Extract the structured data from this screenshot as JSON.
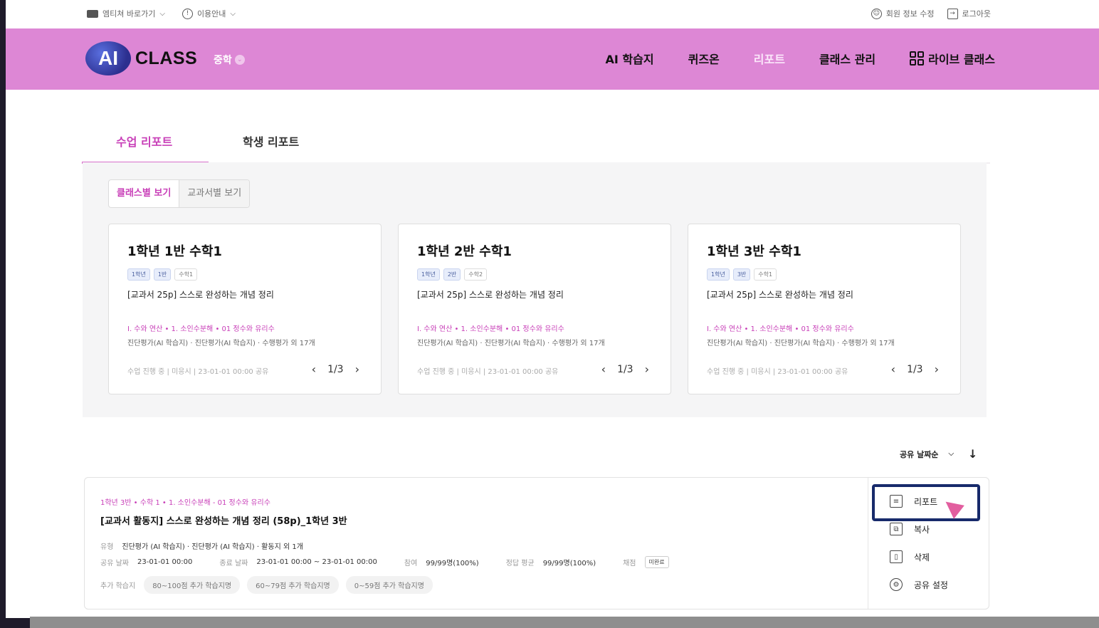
{
  "utilbar": {
    "shortcut_label": "엠티쳐 바로가기",
    "guide_label": "이용안내",
    "profile_label": "회원 정보 수정",
    "logout_label": "로그아웃"
  },
  "header": {
    "logo_ai": "AI",
    "logo_class": "CLASS",
    "grade": "중학",
    "nav": [
      "AI 학습지",
      "퀴즈온",
      "리포트",
      "클래스 관리",
      "라이브 클래스"
    ],
    "active_nav": "리포트"
  },
  "tabs": [
    "수업 리포트",
    "학생 리포트"
  ],
  "view_toggle": [
    "클래스별 보기",
    "교과서별 보기"
  ],
  "cards": [
    {
      "title": "1학년 1반 수학1",
      "tags": [
        "1학년",
        "1반",
        "수학1"
      ],
      "subtitle": "[교과서 25p] 스스로 완성하는 개념 정리",
      "path": "Ⅰ. 수와 연산  •  1. 소인수분해  •  01 정수와 유리수",
      "types": "진단평가(AI 학습지) · 진단평가(AI 학습지) · 수행평가 외 17개",
      "status": "수업 진행 중  |  미응시  |  23-01-01 00:00 공유",
      "pager": "1/3"
    },
    {
      "title": "1학년 2반 수학1",
      "tags": [
        "1학년",
        "2반",
        "수학2"
      ],
      "subtitle": "[교과서 25p] 스스로 완성하는 개념 정리",
      "path": "Ⅰ. 수와 연산  •  1. 소인수분해  •  01 정수와 유리수",
      "types": "진단평가(AI 학습지) · 진단평가(AI 학습지) · 수행평가 외 17개",
      "status": "수업 진행 중  |  미응시  |  23-01-01 00:00 공유",
      "pager": "1/3"
    },
    {
      "title": "1학년 3반 수학1",
      "tags": [
        "1학년",
        "3반",
        "수학1"
      ],
      "subtitle": "[교과서 25p] 스스로 완성하는 개념 정리",
      "path": "Ⅰ. 수와 연산  •  1. 소인수분해  •  01 정수와 유리수",
      "types": "진단평가(AI 학습지) · 진단평가(AI 학습지) · 수행평가 외 17개",
      "status": "수업 진행 중  |  미응시  |  23-01-01 00:00 공유",
      "pager": "1/3"
    }
  ],
  "sort": {
    "label": "공유 날짜순"
  },
  "report_item": {
    "path": "1학년 3반  •  수학 1  •  1. 소인수분해 - 01 정수와 유리수",
    "title": "[교과서 활동지] 스스로 완성하는 개념 정리 (58p)_1학년 3반",
    "type_label": "유형",
    "type_value": "진단평가 (AI 학습지) · 진단평가 (AI 학습지) · 활동지 외 1개",
    "share_label": "공유 날짜",
    "share_value": "23-01-01 00:00",
    "end_label": "종료 날짜",
    "end_value": "23-01-01 00:00 ~ 23-01-01 00:00",
    "participation_label": "참여",
    "participation_value": "99/99명(100%)",
    "average_label": "정답 평균",
    "average_value": "99/99명(100%)",
    "grading_label": "채점",
    "grading_value": "미완료",
    "extra_label": "추가 학습지",
    "extra_pills": [
      "80~100점 추가 학습지명",
      "60~79점 추가 학습지명",
      "0~59점 추가 학습지명"
    ]
  },
  "actions": [
    "리포트",
    "복사",
    "삭제",
    "공유 설정"
  ],
  "colors": {
    "header": "#dd87d5",
    "accent": "#c83fb8",
    "highlight": "#172a6b"
  },
  "icons": [
    "book-icon",
    "info-icon",
    "user-icon",
    "logout-icon",
    "chevron-down-icon",
    "live-grid-icon",
    "chevron-left-icon",
    "chevron-right-icon",
    "arrow-down-icon",
    "report-doc-icon",
    "copy-icon",
    "trash-icon",
    "gear-icon"
  ]
}
